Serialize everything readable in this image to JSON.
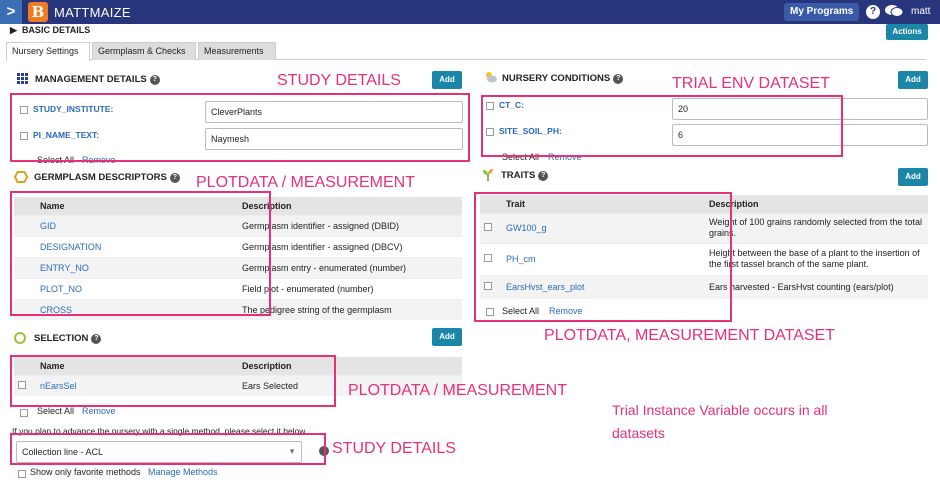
{
  "topbar": {
    "toggle_glyph": ">",
    "logo_letter": "B",
    "brand": "MATTMAIZE",
    "programs_label": "My Programs",
    "help_glyph": "?",
    "user": "matt"
  },
  "basic_details": "BASIC DETAILS",
  "actions_label": "Actions",
  "tabs": [
    "Nursery Settings",
    "Germplasm & Checks",
    "Measurements"
  ],
  "help_glyph": "?",
  "add_label": "Add",
  "management": {
    "title": "MANAGEMENT DETAILS",
    "rows": [
      {
        "label": "STUDY_INSTITUTE:",
        "value": "CleverPlants"
      },
      {
        "label": "PI_NAME_TEXT:",
        "value": "Naymesh"
      }
    ],
    "select_all": "Select All",
    "remove": "Remove"
  },
  "nursery_conditions": {
    "title": "NURSERY CONDITIONS",
    "rows": [
      {
        "label": "CT_C:",
        "value": "20"
      },
      {
        "label": "SITE_SOIL_PH:",
        "value": "6"
      }
    ],
    "select_all": "Select All",
    "remove": "Remove"
  },
  "germplasm": {
    "title": "GERMPLASM DESCRIPTORS",
    "headers": [
      "Name",
      "Description"
    ],
    "rows": [
      {
        "name": "GID",
        "desc": "Germplasm identifier - assigned (DBID)"
      },
      {
        "name": "DESIGNATION",
        "desc": "Germplasm identifier - assigned (DBCV)"
      },
      {
        "name": "ENTRY_NO",
        "desc": "Germplasm entry - enumerated (number)"
      },
      {
        "name": "PLOT_NO",
        "desc": "Field plot - enumerated (number)"
      },
      {
        "name": "CROSS",
        "desc": "The pedigree string of the germplasm"
      }
    ]
  },
  "traits": {
    "title": "TRAITS",
    "headers": [
      "Trait",
      "Description"
    ],
    "rows": [
      {
        "name": "GW100_g",
        "desc1": "Weight of 100 grains randomly selected from the total",
        "desc2": "grains."
      },
      {
        "name": "PH_cm",
        "desc1": "Height between the base of a plant to the insertion of",
        "desc2": "the first tassel branch of the same plant."
      },
      {
        "name": "EarsHvst_ears_plot",
        "desc1": "Ears harvested - EarsHvst counting (ears/plot)",
        "desc2": ""
      }
    ],
    "select_all": "Select All",
    "remove": "Remove"
  },
  "selection": {
    "title": "SELECTION",
    "headers": [
      "Name",
      "Description"
    ],
    "rows": [
      {
        "name": "nEarsSel",
        "desc": "Ears Selected"
      }
    ],
    "select_all": "Select All",
    "remove": "Remove",
    "method_prompt": "If you plan to advance the nursery with a single method, please select it below",
    "method_value": "Collection line - ACL",
    "favorites_label": "Show only favorite methods",
    "manage_methods": "Manage Methods"
  },
  "annotations": {
    "study_details_1": "STUDY DETAILS",
    "trial_env": "TRIAL ENV DATASET",
    "plotdata_1": "PLOTDATA / MEASUREMENT",
    "plotdata_2": "PLOTDATA, MEASUREMENT DATASET",
    "plotdata_3": "PLOTDATA / MEASUREMENT",
    "study_details_2": "STUDY DETAILS",
    "trial_instance_1": "Trial Instance Variable occurs in all",
    "trial_instance_2": "datasets"
  },
  "colors": {
    "accent": "#1b86a8",
    "topbar": "#27367c",
    "annotation": "#e8307a",
    "link": "#2a6bb8"
  }
}
